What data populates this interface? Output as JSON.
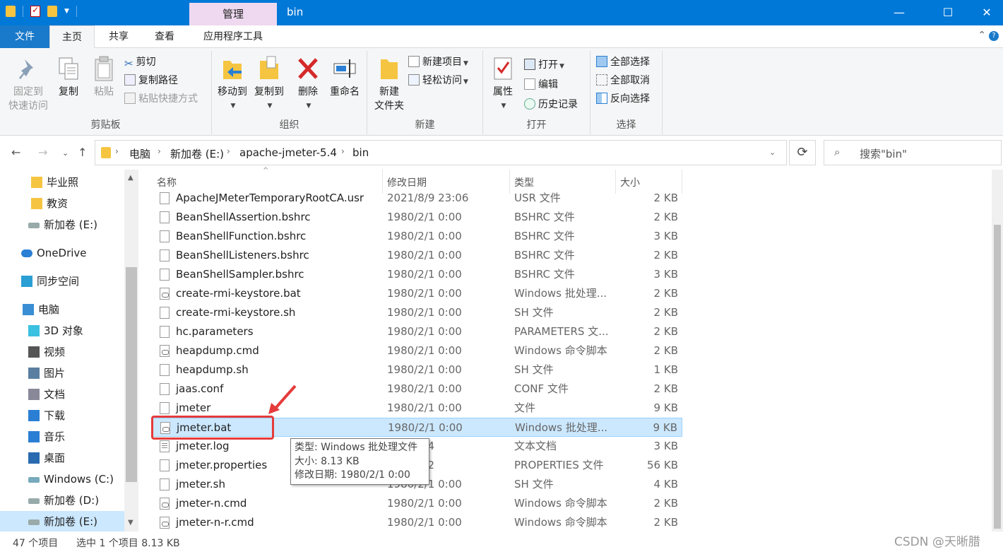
{
  "window": {
    "contextual_tab": "管理",
    "title": "bin",
    "minimize": "—",
    "maximize": "☐",
    "close": "✕"
  },
  "tabs": {
    "file": "文件",
    "home": "主页",
    "share": "共享",
    "view": "查看",
    "app_tools": "应用程序工具"
  },
  "ribbon": {
    "clipboard": {
      "label": "剪贴板",
      "pin_line1": "固定到",
      "pin_line2": "快速访问",
      "copy": "复制",
      "paste": "粘贴",
      "cut": "剪切",
      "copy_path": "复制路径",
      "paste_shortcut": "粘贴快捷方式"
    },
    "organize": {
      "label": "组织",
      "move_to": "移动到",
      "copy_to": "复制到",
      "delete": "删除",
      "rename": "重命名"
    },
    "new": {
      "label": "新建",
      "new_folder_line1": "新建",
      "new_folder_line2": "文件夹",
      "new_item": "新建项目",
      "easy_access": "轻松访问"
    },
    "open": {
      "label": "打开",
      "properties": "属性",
      "open": "打开",
      "edit": "编辑",
      "history": "历史记录"
    },
    "select": {
      "label": "选择",
      "select_all": "全部选择",
      "select_none": "全部取消",
      "invert": "反向选择"
    }
  },
  "address": {
    "crumbs": [
      "电脑",
      "新加卷 (E:)",
      "apache-jmeter-5.4",
      "bin"
    ],
    "search_placeholder": "搜索\"bin\""
  },
  "nav": {
    "items": [
      {
        "label": "毕业照",
        "icon": "folder-icon"
      },
      {
        "label": "教资",
        "icon": "folder-icon"
      },
      {
        "label": "新加卷 (E:)",
        "icon": "drive-icon"
      },
      {
        "label": "OneDrive",
        "icon": "cloud-icon"
      },
      {
        "label": "同步空间",
        "icon": "sync-icon"
      },
      {
        "label": "电脑",
        "icon": "computer-icon"
      },
      {
        "label": "3D 对象",
        "icon": "cube-icon"
      },
      {
        "label": "视频",
        "icon": "video-icon"
      },
      {
        "label": "图片",
        "icon": "picture-icon"
      },
      {
        "label": "文档",
        "icon": "document-icon"
      },
      {
        "label": "下载",
        "icon": "download-icon"
      },
      {
        "label": "音乐",
        "icon": "music-icon"
      },
      {
        "label": "桌面",
        "icon": "desktop-icon"
      },
      {
        "label": "Windows (C:)",
        "icon": "windows-drive-icon"
      },
      {
        "label": "新加卷 (D:)",
        "icon": "drive-icon"
      },
      {
        "label": "新加卷 (E:)",
        "icon": "drive-icon"
      }
    ]
  },
  "columns": {
    "name": "名称",
    "date": "修改日期",
    "type": "类型",
    "size": "大小"
  },
  "files": [
    {
      "name": "ApacheJMeterTemporaryRootCA.usr",
      "date": "2021/8/9 23:06",
      "type": "USR 文件",
      "size": "2 KB",
      "icon": "file"
    },
    {
      "name": "BeanShellAssertion.bshrc",
      "date": "1980/2/1 0:00",
      "type": "BSHRC 文件",
      "size": "2 KB",
      "icon": "file"
    },
    {
      "name": "BeanShellFunction.bshrc",
      "date": "1980/2/1 0:00",
      "type": "BSHRC 文件",
      "size": "3 KB",
      "icon": "file"
    },
    {
      "name": "BeanShellListeners.bshrc",
      "date": "1980/2/1 0:00",
      "type": "BSHRC 文件",
      "size": "2 KB",
      "icon": "file"
    },
    {
      "name": "BeanShellSampler.bshrc",
      "date": "1980/2/1 0:00",
      "type": "BSHRC 文件",
      "size": "3 KB",
      "icon": "file"
    },
    {
      "name": "create-rmi-keystore.bat",
      "date": "1980/2/1 0:00",
      "type": "Windows 批处理...",
      "size": "2 KB",
      "icon": "bat"
    },
    {
      "name": "create-rmi-keystore.sh",
      "date": "1980/2/1 0:00",
      "type": "SH 文件",
      "size": "2 KB",
      "icon": "file"
    },
    {
      "name": "hc.parameters",
      "date": "1980/2/1 0:00",
      "type": "PARAMETERS 文...",
      "size": "2 KB",
      "icon": "file"
    },
    {
      "name": "heapdump.cmd",
      "date": "1980/2/1 0:00",
      "type": "Windows 命令脚本",
      "size": "2 KB",
      "icon": "bat"
    },
    {
      "name": "heapdump.sh",
      "date": "1980/2/1 0:00",
      "type": "SH 文件",
      "size": "1 KB",
      "icon": "file"
    },
    {
      "name": "jaas.conf",
      "date": "1980/2/1 0:00",
      "type": "CONF 文件",
      "size": "2 KB",
      "icon": "file"
    },
    {
      "name": "jmeter",
      "date": "1980/2/1 0:00",
      "type": "文件",
      "size": "9 KB",
      "icon": "file"
    },
    {
      "name": "jmeter.bat",
      "date": "1980/2/1 0:00",
      "type": "Windows 批处理...",
      "size": "9 KB",
      "icon": "bat",
      "selected": true
    },
    {
      "name": "jmeter.log",
      "date": "12 15:44",
      "type": "文本文档",
      "size": "3 KB",
      "icon": "log"
    },
    {
      "name": "jmeter.properties",
      "date": "15 22:12",
      "type": "PROPERTIES 文件",
      "size": "56 KB",
      "icon": "file"
    },
    {
      "name": "jmeter.sh",
      "date": "1980/2/1 0:00",
      "type": "SH 文件",
      "size": "4 KB",
      "icon": "file"
    },
    {
      "name": "jmeter-n.cmd",
      "date": "1980/2/1 0:00",
      "type": "Windows 命令脚本",
      "size": "2 KB",
      "icon": "bat"
    },
    {
      "name": "jmeter-n-r.cmd",
      "date": "1980/2/1 0:00",
      "type": "Windows 命令脚本",
      "size": "2 KB",
      "icon": "bat"
    }
  ],
  "tooltip": {
    "type": "类型: Windows 批处理文件",
    "size": "大小: 8.13 KB",
    "date": "修改日期: 1980/2/1 0:00"
  },
  "status": {
    "count": "47 个项目",
    "selected": "选中 1 个项目  8.13 KB"
  },
  "watermark": "CSDN @天晰腊",
  "colors": {
    "titlebar": "#0078d7",
    "selection": "#cce8ff",
    "annotation": "#e53b3b"
  }
}
